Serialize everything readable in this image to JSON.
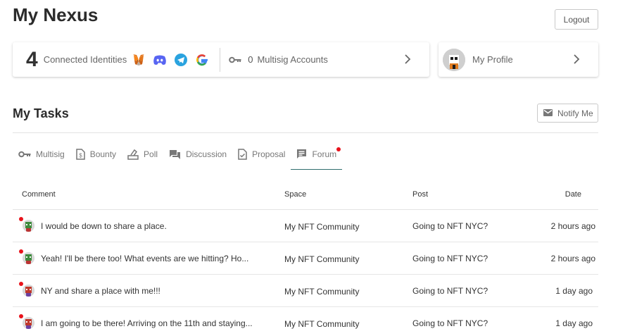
{
  "page": {
    "title": "My Nexus",
    "logout_label": "Logout"
  },
  "identities": {
    "count": "4",
    "label": "Connected Identities",
    "icons": [
      "metamask-icon",
      "discord-icon",
      "telegram-icon",
      "google-icon"
    ],
    "multisig_count": "0",
    "multisig_label": "Multisig Accounts"
  },
  "profile": {
    "label": "My Profile"
  },
  "tasks": {
    "title": "My Tasks",
    "notify_label": "Notify Me",
    "tabs": [
      {
        "label": "Multisig",
        "icon": "key-icon"
      },
      {
        "label": "Bounty",
        "icon": "dollar-doc-icon"
      },
      {
        "label": "Poll",
        "icon": "poll-icon"
      },
      {
        "label": "Discussion",
        "icon": "chat-icon"
      },
      {
        "label": "Proposal",
        "icon": "proposal-doc-icon"
      },
      {
        "label": "Forum",
        "icon": "forum-icon",
        "active": true,
        "badge": true
      }
    ],
    "columns": {
      "comment": "Comment",
      "space": "Space",
      "post": "Post",
      "date": "Date"
    },
    "rows": [
      {
        "comment": "I would be down to share a place.",
        "space": "My NFT Community",
        "post": "Going to NFT NYC?",
        "date": "2 hours ago"
      },
      {
        "comment": "Yeah! I'll be there too! What events are we hitting? Ho...",
        "space": "My NFT Community",
        "post": "Going to NFT NYC?",
        "date": "2 hours ago"
      },
      {
        "comment": "NY and share a place with me!!!",
        "space": "My NFT Community",
        "post": "Going to NFT NYC?",
        "date": "1 day ago"
      },
      {
        "comment": "I am going to be there! Arriving on the 11th and staying...",
        "space": "My NFT Community",
        "post": "Going to NFT NYC?",
        "date": "1 day ago"
      }
    ]
  },
  "colors": {
    "accent": "#2f6e6e",
    "badge": "#e8121b",
    "discord": "#5865f2",
    "telegram": "#2aa3df"
  }
}
